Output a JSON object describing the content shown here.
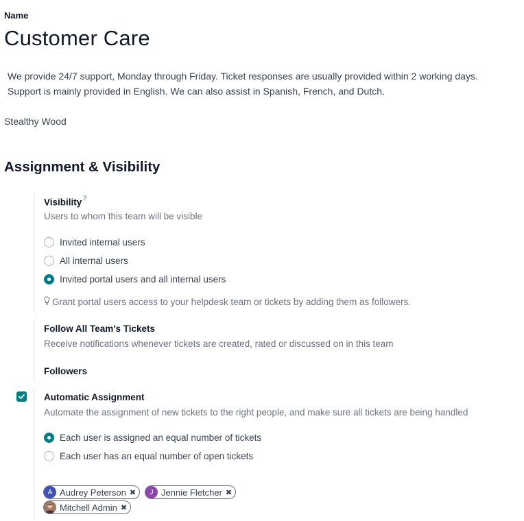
{
  "form": {
    "name_label": "Name",
    "name": "Customer Care",
    "description_line1": "We provide 24/7 support, Monday through Friday. Ticket responses are usually provided within 2 working days.",
    "description_line2": "Support is mainly provided in English. We can also assist in Spanish, French, and Dutch.",
    "company": "Stealthy Wood"
  },
  "section": {
    "title": "Assignment & Visibility"
  },
  "visibility": {
    "label": "Visibility",
    "tooltip_marker": "?",
    "help": "Users to whom this team will be visible",
    "options": [
      {
        "label": "Invited internal users",
        "checked": false
      },
      {
        "label": "All internal users",
        "checked": false
      },
      {
        "label": "Invited portal users and all internal users",
        "checked": true
      }
    ],
    "hint": "Grant portal users access to your helpdesk team or tickets by adding them as followers."
  },
  "follow_all": {
    "label": "Follow All Team's Tickets",
    "help": "Receive notifications whenever tickets are created, rated or discussed on in this team"
  },
  "followers": {
    "label": "Followers"
  },
  "auto_assignment": {
    "checked": true,
    "label": "Automatic Assignment",
    "help": "Automate the assignment of new tickets to the right people, and make sure all tickets are being handled",
    "options": [
      {
        "label": "Each user is assigned an equal number of tickets",
        "checked": true
      },
      {
        "label": "Each user has an equal number of open tickets",
        "checked": false
      }
    ],
    "members": [
      {
        "initial": "A",
        "name": "Audrey Peterson",
        "color": "#3f51b5"
      },
      {
        "initial": "J",
        "name": "Jennie Fletcher",
        "color": "#8e44ad"
      },
      {
        "initial": "",
        "name": "Mitchell Admin",
        "color": "#8d6e63"
      }
    ]
  },
  "colors": {
    "accent": "#017e84",
    "text": "#374151",
    "muted": "#6b7280"
  }
}
